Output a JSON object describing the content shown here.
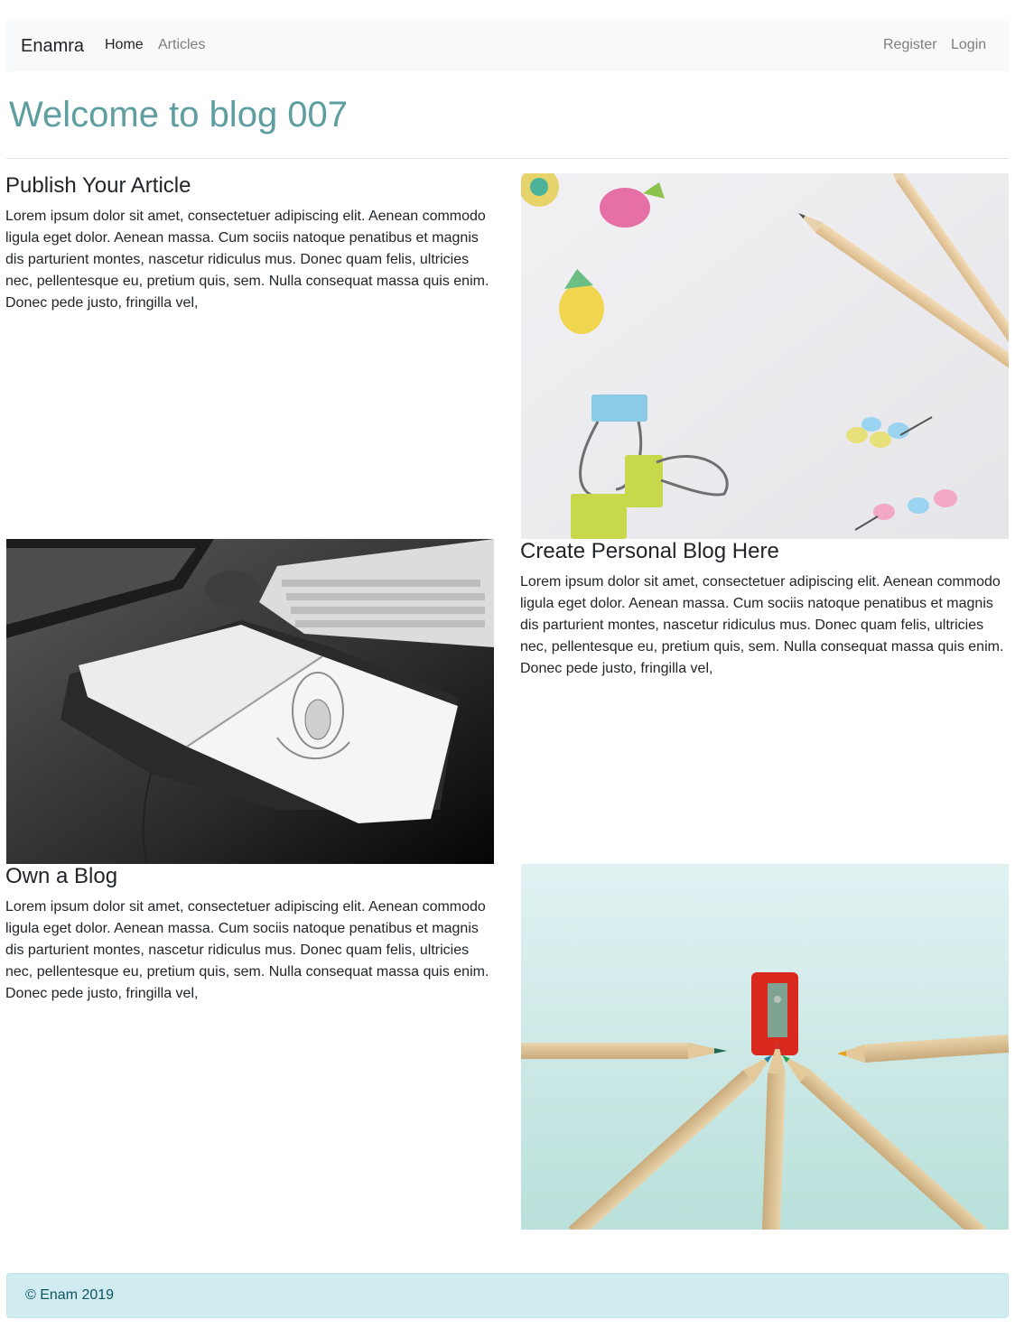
{
  "navbar": {
    "brand": "Enamra",
    "links": [
      {
        "label": "Home",
        "active": true
      },
      {
        "label": "Articles",
        "active": false
      }
    ],
    "right_links": [
      {
        "label": "Register"
      },
      {
        "label": "Login"
      }
    ]
  },
  "page": {
    "title": "Welcome to blog 007"
  },
  "sections": [
    {
      "heading": "Publish Your Article",
      "body": "Lorem ipsum dolor sit amet, consectetuer adipiscing elit. Aenean commodo ligula eget dolor. Aenean massa. Cum sociis natoque penatibus et magnis dis parturient montes, nascetur ridiculus mus. Donec quam felis, ultricies nec, pellentesque eu, pretium quis, sem. Nulla consequat massa quis enim. Donec pede justo, fringilla vel,",
      "image": "photo-stationery-pencils-clips-pins"
    },
    {
      "heading": "Create Personal Blog Here",
      "body": "Lorem ipsum dolor sit amet, consectetuer adipiscing elit. Aenean commodo ligula eget dolor. Aenean massa. Cum sociis natoque penatibus et magnis dis parturient montes, nascetur ridiculus mus. Donec quam felis, ultricies nec, pellentesque eu, pretium quis, sem. Nulla consequat massa quis enim. Donec pede justo, fringilla vel,",
      "image": "photo-sketchbook-keyboard-bw"
    },
    {
      "heading": "Own a Blog",
      "body": "Lorem ipsum dolor sit amet, consectetuer adipiscing elit. Aenean commodo ligula eget dolor. Aenean massa. Cum sociis natoque penatibus et magnis dis parturient montes, nascetur ridiculus mus. Donec quam felis, ultricies nec, pellentesque eu, pretium quis, sem. Nulla consequat massa quis enim. Donec pede justo, fringilla vel,",
      "image": "photo-colored-pencils-sharpener"
    }
  ],
  "footer": {
    "text": "© Enam 2019"
  }
}
